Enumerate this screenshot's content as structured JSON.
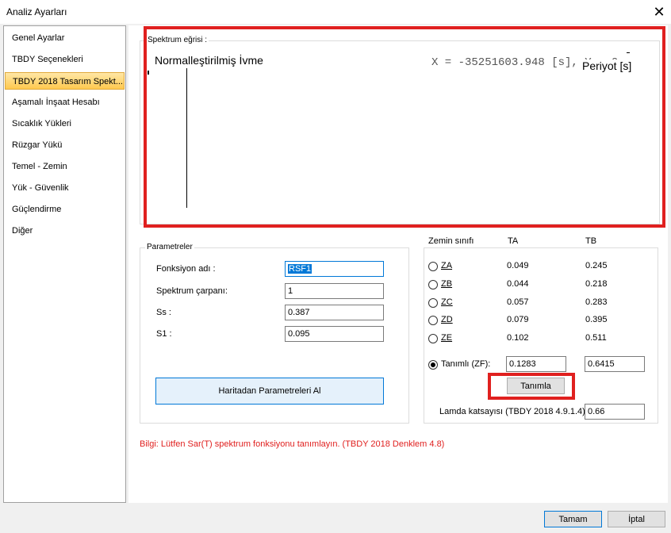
{
  "window": {
    "title": "Analiz Ayarları"
  },
  "sidebar": {
    "items": [
      {
        "label": "Genel Ayarlar"
      },
      {
        "label": "TBDY Seçenekleri"
      },
      {
        "label": "TBDY 2018 Tasarım Spekt..."
      },
      {
        "label": "Aşamalı İnşaat Hesabı"
      },
      {
        "label": "Sıcaklık Yükleri"
      },
      {
        "label": "Rüzgar Yükü"
      },
      {
        "label": "Temel - Zemin"
      },
      {
        "label": "Yük - Güvenlik"
      },
      {
        "label": "Güçlendirme"
      },
      {
        "label": "Diğer"
      }
    ],
    "active_index": 2
  },
  "spectrum": {
    "group_label": "Spektrum eğrisi :",
    "y_axis_label": "Normalleştirilmiş İvme",
    "x_axis_label": "Periyot [s]",
    "cursor_readout": "X = -35251603.948 [s],  Y = 0"
  },
  "parameters": {
    "group_label": "Parametreler",
    "function_name_label": "Fonksiyon adı :",
    "function_name_value": "RSF1",
    "multiplier_label": "Spektrum çarpanı:",
    "multiplier_value": "1",
    "ss_label": "Ss :",
    "ss_value": "0.387",
    "s1_label": "S1 :",
    "s1_value": "0.095",
    "map_button_label": "Haritadan Parametreleri Al"
  },
  "soil": {
    "header_class": "Zemin sınıfı",
    "header_ta": "TA",
    "header_tb": "TB",
    "classes": [
      {
        "label": "ZA",
        "ta": "0.049",
        "tb": "0.245"
      },
      {
        "label": "ZB",
        "ta": "0.044",
        "tb": "0.218"
      },
      {
        "label": "ZC",
        "ta": "0.057",
        "tb": "0.283"
      },
      {
        "label": "ZD",
        "ta": "0.079",
        "tb": "0.395"
      },
      {
        "label": "ZE",
        "ta": "0.102",
        "tb": "0.511"
      }
    ],
    "defined_label": "Tanımlı (ZF):",
    "defined_ta": "0.1283",
    "defined_tb": "0.6415",
    "define_button_label": "Tanımla",
    "lambda_label": "Lamda katsayısı (TBDY 2018 4.9.1.4) :",
    "lambda_value": "0.66"
  },
  "info_text": "Bilgi: Lütfen Sar(T) spektrum fonksiyonu tanımlayın. (TBDY 2018 Denklem 4.8)",
  "footer": {
    "ok_label": "Tamam",
    "cancel_label": "İptal"
  },
  "colors": {
    "highlight": "#e0201f",
    "selection": "#0078d7",
    "sidebar_active": "#ffc94f"
  }
}
